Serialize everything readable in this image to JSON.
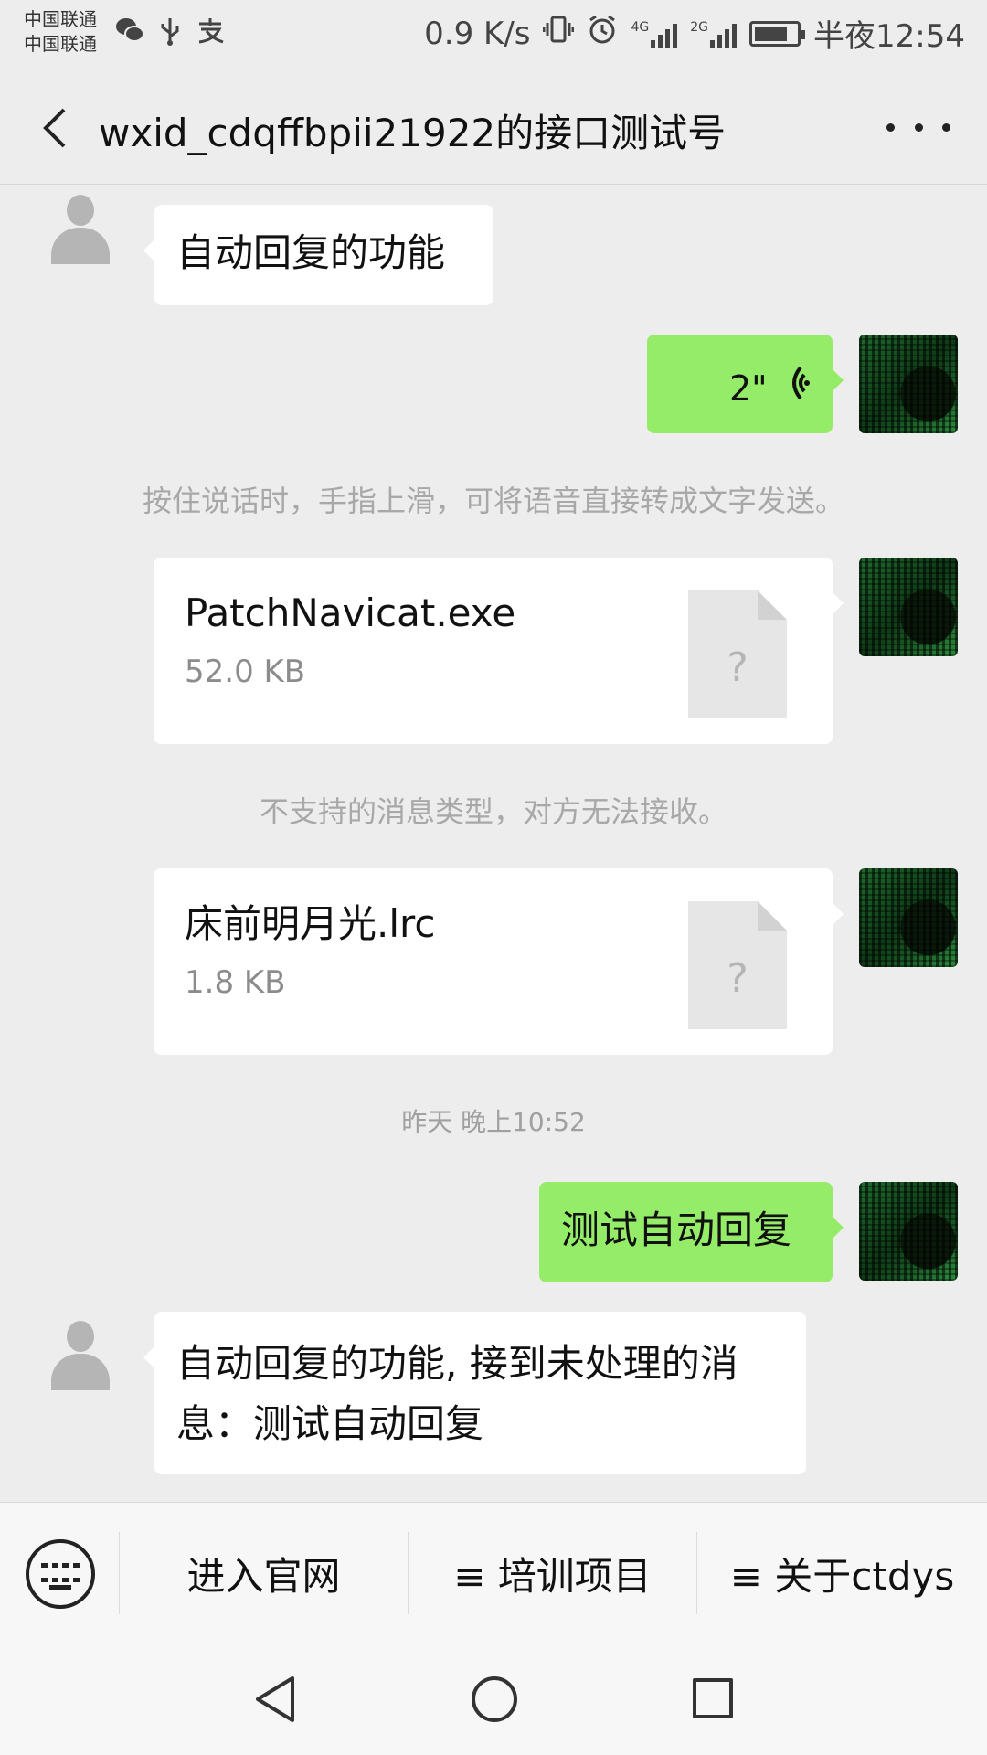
{
  "status_bar": {
    "carrier_1": "中国联通",
    "carrier_2": "中国联通",
    "left_icons": [
      "wechat-icon",
      "usb-icon",
      "alipay-icon"
    ],
    "net_speed": "0.9 K/s",
    "network_1": "4G",
    "network_2": "2G",
    "time": "半夜12:54"
  },
  "header": {
    "title": "wxid_cdqffbpii21922的接口测试号"
  },
  "messages": {
    "m1_text": "自动回复的功能",
    "m2_voice_duration": "2\"",
    "m3_note": "按住说话时，手指上滑，可将语音直接转成文字发送。",
    "m4_file_name": "PatchNavicat.exe",
    "m4_file_size": "52.0 KB",
    "m4_file_glyph": "?",
    "m5_note": "不支持的消息类型，对方无法接收。",
    "m6_file_name": "床前明月光.lrc",
    "m6_file_size": "1.8 KB",
    "m6_file_glyph": "?",
    "m7_timestamp": "昨天 晚上10:52",
    "m8_text": "测试自动回复",
    "m9_text": "自动回复的功能, 接到未处理的消息：测试自动回复"
  },
  "menu": {
    "item_1": "进入官网",
    "item_2": "≡ 培训项目",
    "item_3": "≡ 关于ctdys"
  },
  "colors": {
    "background": "#ededed",
    "sent_bubble": "#95ec69",
    "received_bubble": "#ffffff",
    "system_text": "#a8a8a8"
  }
}
